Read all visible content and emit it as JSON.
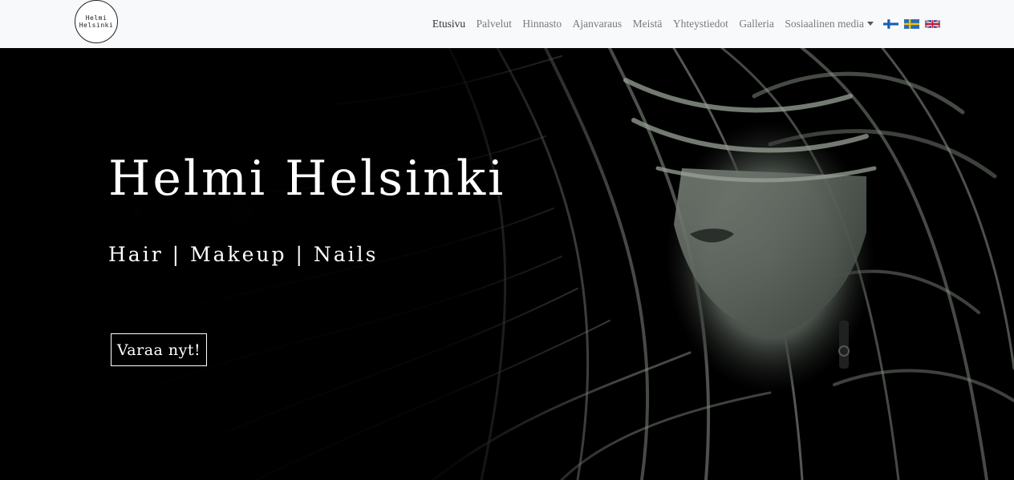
{
  "logo": {
    "line1": "Helmi",
    "line2": "Helsinki"
  },
  "nav": {
    "items": [
      {
        "label": "Etusivu"
      },
      {
        "label": "Palvelut"
      },
      {
        "label": "Hinnasto"
      },
      {
        "label": "Ajanvaraus"
      },
      {
        "label": "Meistä"
      },
      {
        "label": "Yhteystiedot"
      },
      {
        "label": "Galleria"
      },
      {
        "label": "Sosiaalinen media"
      }
    ],
    "flags": [
      "finnish-flag-icon",
      "swedish-flag-icon",
      "uk-flag-icon"
    ]
  },
  "hero": {
    "title": "Helmi Helsinki",
    "subtitle": "Hair | Makeup | Nails",
    "cta_label": "Varaa nyt!"
  },
  "colors": {
    "navbar_bg": "#f8f9fa",
    "hero_bg": "#000000",
    "hair_tint": "#8a9388",
    "text_white": "#ffffff"
  }
}
